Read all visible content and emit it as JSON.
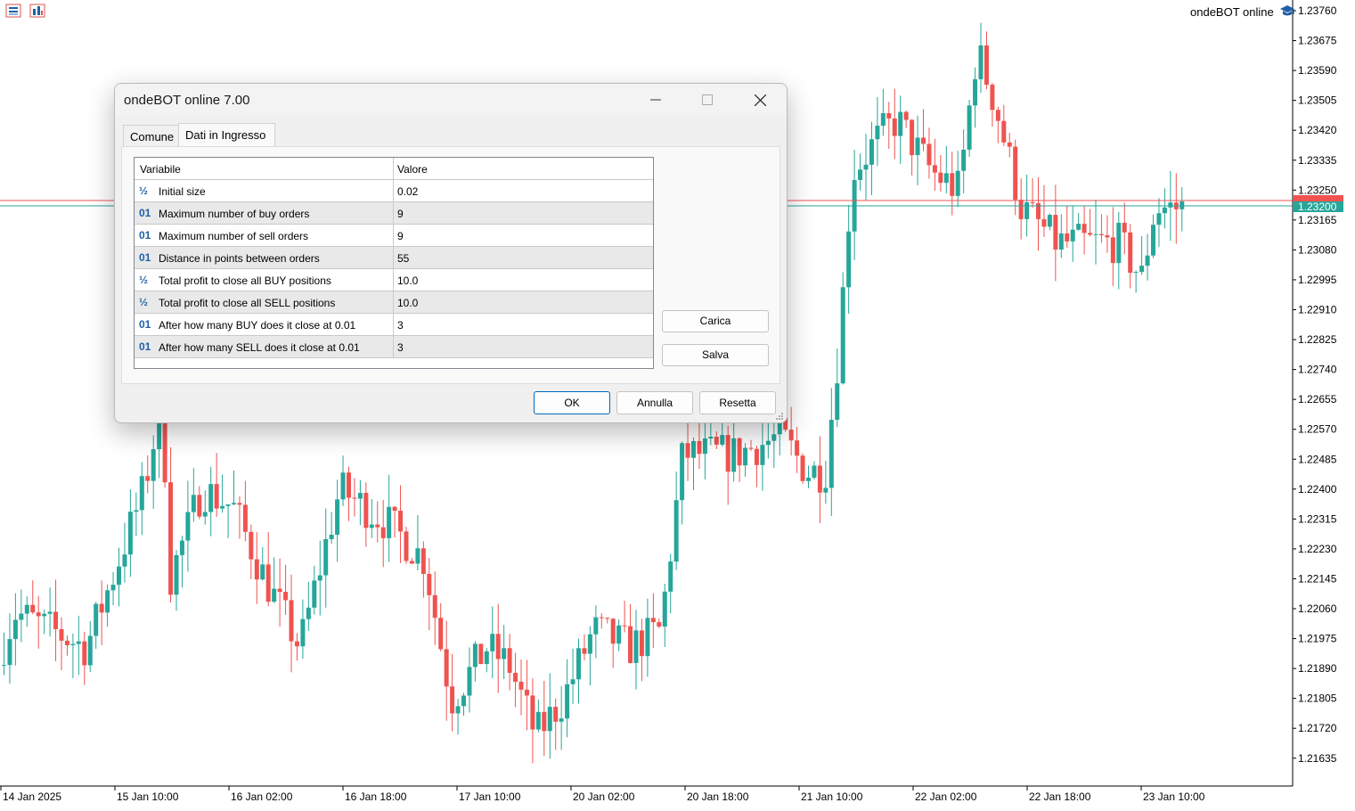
{
  "chart": {
    "expert_label": "ondeBOT online",
    "price_axis": [
      "1.23760",
      "1.23675",
      "1.23590",
      "1.23505",
      "1.23420",
      "1.23335",
      "1.23250",
      "1.23165",
      "1.23080",
      "1.22995",
      "1.22910",
      "1.22825",
      "1.22740",
      "1.22655",
      "1.22570",
      "1.22485",
      "1.22400",
      "1.22315",
      "1.22230",
      "1.22145",
      "1.22060",
      "1.21975",
      "1.21890",
      "1.21805",
      "1.21720",
      "1.21635"
    ],
    "time_axis": [
      "14 Jan 2025",
      "15 Jan 10:00",
      "16 Jan 02:00",
      "16 Jan 18:00",
      "17 Jan 10:00",
      "20 Jan 02:00",
      "20 Jan 18:00",
      "21 Jan 10:00",
      "22 Jan 02:00",
      "22 Jan 18:00",
      "23 Jan 10:00"
    ],
    "current_price": "1.23200",
    "colors": {
      "bull": "#26a69a",
      "bear": "#ef5350",
      "ask_line": "#ef5350",
      "bid_line": "#26a69a"
    }
  },
  "dialog": {
    "title": "ondeBOT online 7.00",
    "tabs": [
      {
        "label": "Comune"
      },
      {
        "label": "Dati in Ingresso"
      }
    ],
    "grid": {
      "header_variable": "Variabile",
      "header_value": "Valore",
      "rows": [
        {
          "type": "double",
          "icon": "½",
          "name": "Initial size",
          "value": "0.02"
        },
        {
          "type": "int",
          "icon": "01",
          "name": "Maximum number of buy orders",
          "value": "9"
        },
        {
          "type": "int",
          "icon": "01",
          "name": "Maximum number of sell orders",
          "value": "9"
        },
        {
          "type": "int",
          "icon": "01",
          "name": "Distance in points between orders",
          "value": "55"
        },
        {
          "type": "double",
          "icon": "½",
          "name": "Total profit to close all BUY positions",
          "value": "10.0"
        },
        {
          "type": "double",
          "icon": "½",
          "name": "Total profit to close all SELL positions",
          "value": "10.0"
        },
        {
          "type": "int",
          "icon": "01",
          "name": "After how many BUY does it close at 0.01",
          "value": "3"
        },
        {
          "type": "int",
          "icon": "01",
          "name": "After how many SELL does it close at 0.01",
          "value": "3"
        }
      ]
    },
    "side_buttons": {
      "load": "Carica",
      "save": "Salva"
    },
    "buttons": {
      "ok": "OK",
      "cancel": "Annulla",
      "reset": "Resetta"
    }
  }
}
